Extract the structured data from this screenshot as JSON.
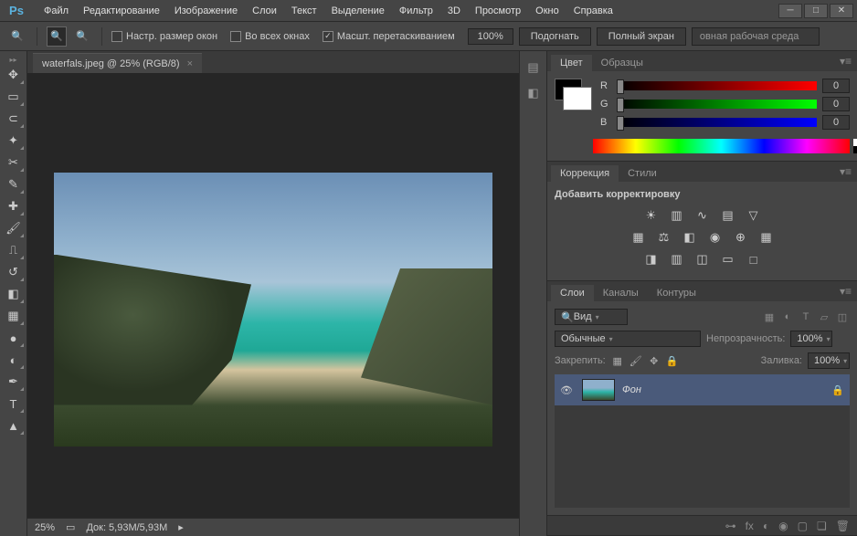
{
  "app": {
    "logo": "Ps"
  },
  "menu": [
    "Файл",
    "Редактирование",
    "Изображение",
    "Слои",
    "Текст",
    "Выделение",
    "Фильтр",
    "3D",
    "Просмотр",
    "Окно",
    "Справка"
  ],
  "options": {
    "resize_windows": "Настр. размер окон",
    "all_windows": "Во всех окнах",
    "scrubby_zoom": "Масшт. перетаскиванием",
    "zoom_value": "100%",
    "fit": "Подогнать",
    "fullscreen": "Полный экран",
    "workspace": "овная рабочая среда"
  },
  "document": {
    "tab_title": "waterfals.jpeg @ 25% (RGB/8)",
    "zoom": "25%",
    "doc_info": "Док: 5,93M/5,93M"
  },
  "panels": {
    "color": {
      "tabs": [
        "Цвет",
        "Образцы"
      ],
      "channels": [
        {
          "label": "R",
          "value": "0"
        },
        {
          "label": "G",
          "value": "0"
        },
        {
          "label": "B",
          "value": "0"
        }
      ]
    },
    "adjustments": {
      "tabs": [
        "Коррекция",
        "Стили"
      ],
      "title": "Добавить корректировку"
    },
    "layers": {
      "tabs": [
        "Слои",
        "Каналы",
        "Контуры"
      ],
      "filter_kind": "Вид",
      "blend_mode": "Обычные",
      "opacity_label": "Непрозрачность:",
      "opacity_value": "100%",
      "lock_label": "Закрепить:",
      "fill_label": "Заливка:",
      "fill_value": "100%",
      "layer_name": "Фон"
    }
  }
}
